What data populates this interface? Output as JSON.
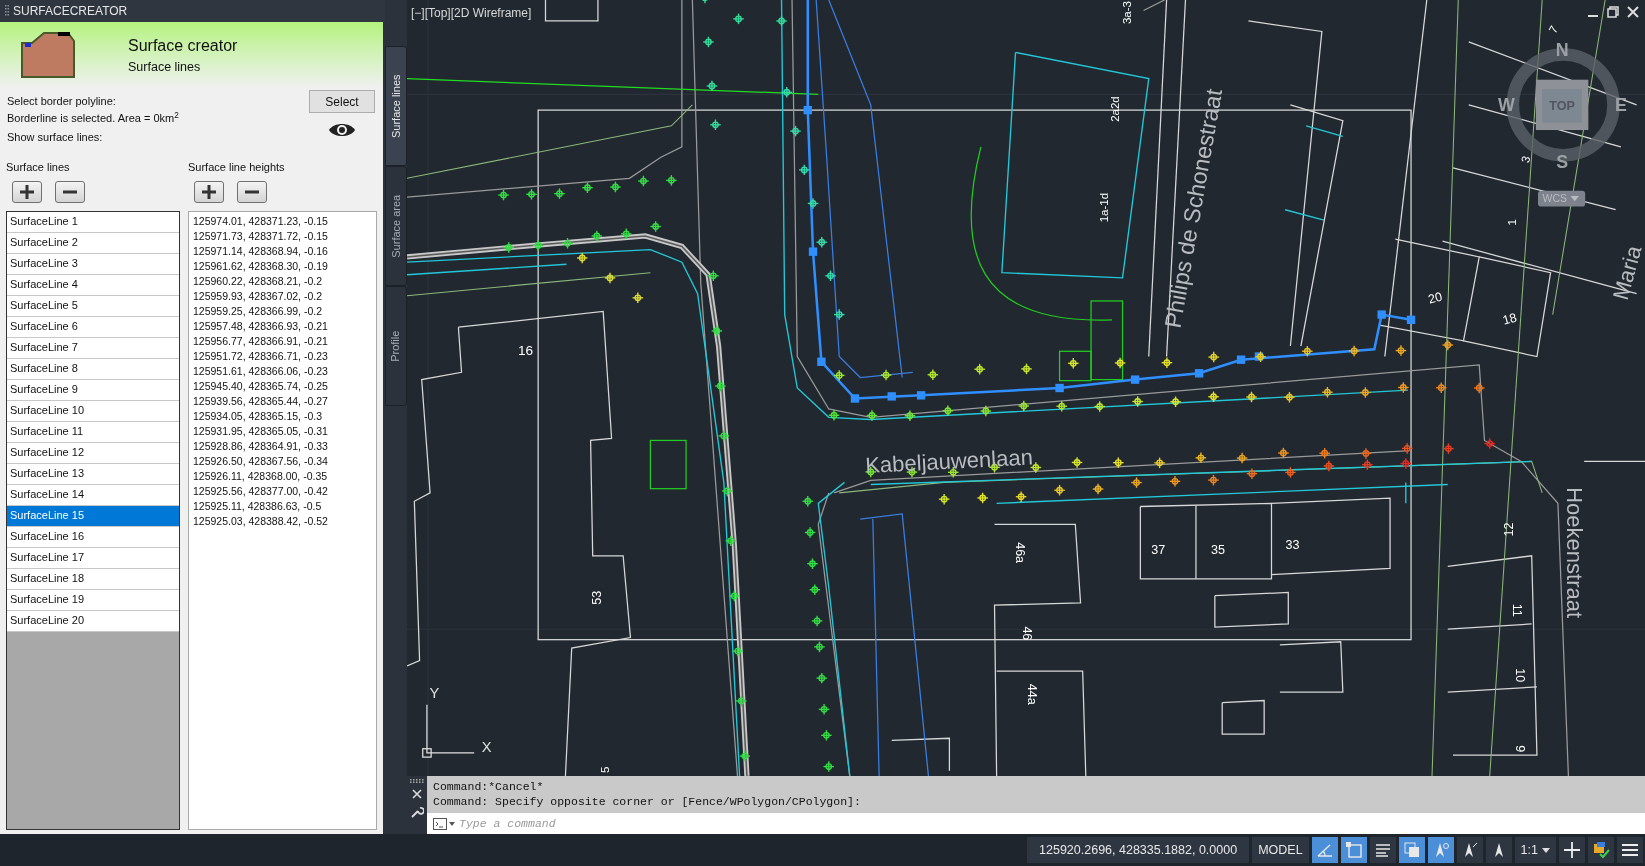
{
  "panel": {
    "title": "SURFACECREATOR",
    "header": {
      "title": "Surface creator",
      "subtitle": "Surface lines"
    },
    "border_label": "Select border polyline:",
    "select_button": "Select",
    "border_status": "Borderline is selected. Area = 0km$^{2}$",
    "show_label": "Show surface lines:",
    "show_surface_lines": true,
    "lines_heading": "Surface lines",
    "heights_heading": "Surface line heights",
    "surface_lines": [
      {
        "label": "SurfaceLine 1",
        "selected": false
      },
      {
        "label": "SurfaceLine 2",
        "selected": false
      },
      {
        "label": "SurfaceLine 3",
        "selected": false
      },
      {
        "label": "SurfaceLine 4",
        "selected": false
      },
      {
        "label": "SurfaceLine 5",
        "selected": false
      },
      {
        "label": "SurfaceLine 6",
        "selected": false
      },
      {
        "label": "SurfaceLine 7",
        "selected": false
      },
      {
        "label": "SurfaceLine 8",
        "selected": false
      },
      {
        "label": "SurfaceLine 9",
        "selected": false
      },
      {
        "label": "SurfaceLine 10",
        "selected": false
      },
      {
        "label": "SurfaceLine 11",
        "selected": false
      },
      {
        "label": "SurfaceLine 12",
        "selected": false
      },
      {
        "label": "SurfaceLine 13",
        "selected": false
      },
      {
        "label": "SurfaceLine 14",
        "selected": false
      },
      {
        "label": "SurfaceLine 15",
        "selected": true
      },
      {
        "label": "SurfaceLine 16",
        "selected": false
      },
      {
        "label": "SurfaceLine 17",
        "selected": false
      },
      {
        "label": "SurfaceLine 18",
        "selected": false
      },
      {
        "label": "SurfaceLine 19",
        "selected": false
      },
      {
        "label": "SurfaceLine 20",
        "selected": false
      }
    ],
    "heights": [
      "125974.01, 428371.23, -0.15",
      "125971.73, 428371.72, -0.15",
      "125971.14, 428368.94, -0.16",
      "125961.62, 428368.30, -0.19",
      "125960.22, 428368.21, -0.2",
      "125959.93, 428367.02, -0.2",
      "125959.25, 428366.99, -0.2",
      "125957.48, 428366.93, -0.21",
      "125956.77, 428366.91, -0.21",
      "125951.72, 428366.71, -0.23",
      "125951.61, 428366.06, -0.23",
      "125945.40, 428365.74, -0.25",
      "125939.56, 428365.44, -0.27",
      "125934.05, 428365.15, -0.3",
      "125931.95, 428365.05, -0.31",
      "125928.86, 428364.91, -0.33",
      "125926.50, 428367.56, -0.34",
      "125926.11, 428368.00, -0.35",
      "125925.56, 428377.00, -0.42",
      "125925.11, 428386.63, -0.5",
      "125925.03, 428388.42, -0.52"
    ]
  },
  "side_tabs": [
    {
      "label": "Surface lines",
      "selected": true
    },
    {
      "label": "Surface area",
      "selected": false
    },
    {
      "label": "Profile",
      "selected": false
    }
  ],
  "viewport": {
    "label": "[−][Top][2D Wireframe]",
    "map_labels": [
      {
        "text": "3a-3",
        "kind": "number"
      },
      {
        "text": "2a2d",
        "kind": "number"
      },
      {
        "text": "1a-1d",
        "kind": "number"
      },
      {
        "text": "Philips de Schonestraat",
        "kind": "street"
      },
      {
        "text": "16",
        "kind": "number"
      },
      {
        "text": "Kabeljauwenlaan",
        "kind": "street"
      },
      {
        "text": "53",
        "kind": "number"
      },
      {
        "text": "20",
        "kind": "number"
      },
      {
        "text": "18",
        "kind": "number"
      },
      {
        "text": "37",
        "kind": "number"
      },
      {
        "text": "35",
        "kind": "number"
      },
      {
        "text": "33",
        "kind": "number"
      },
      {
        "text": "46a",
        "kind": "number"
      },
      {
        "text": "46",
        "kind": "number"
      },
      {
        "text": "44a",
        "kind": "number"
      },
      {
        "text": "Hoekenstraat",
        "kind": "street"
      },
      {
        "text": "12",
        "kind": "number"
      },
      {
        "text": "11",
        "kind": "number"
      },
      {
        "text": "10",
        "kind": "number"
      },
      {
        "text": "9",
        "kind": "number"
      },
      {
        "text": "1",
        "kind": "number"
      },
      {
        "text": "3",
        "kind": "number"
      },
      {
        "text": "7",
        "kind": "number"
      },
      {
        "text": "Maria",
        "kind": "street"
      },
      {
        "text": "5",
        "kind": "number"
      }
    ],
    "compass": {
      "north": "N",
      "west": "W",
      "east": "E",
      "south": "S",
      "face": "TOP",
      "ucs": "WCS"
    },
    "axis_x": "X",
    "axis_y": "Y"
  },
  "command": {
    "history": [
      "Command:*Cancel*",
      "Command: Specify opposite corner or [Fence/WPolygon/CPolygon]:"
    ],
    "placeholder": "Type a command"
  },
  "status_bar": {
    "coordinates": "125920.2696, 428335.1882, 0.0000",
    "model": "MODEL",
    "toggles": [
      {
        "kind": "ortho",
        "on": true
      },
      {
        "kind": "snap",
        "on": true
      },
      {
        "kind": "lineweight",
        "on": false
      },
      {
        "kind": "transparency",
        "on": true
      },
      {
        "kind": "annotation",
        "on": true
      },
      {
        "kind": "autoscale",
        "on": false
      },
      {
        "kind": "visibility",
        "on": false
      }
    ],
    "scale": "1:1"
  }
}
